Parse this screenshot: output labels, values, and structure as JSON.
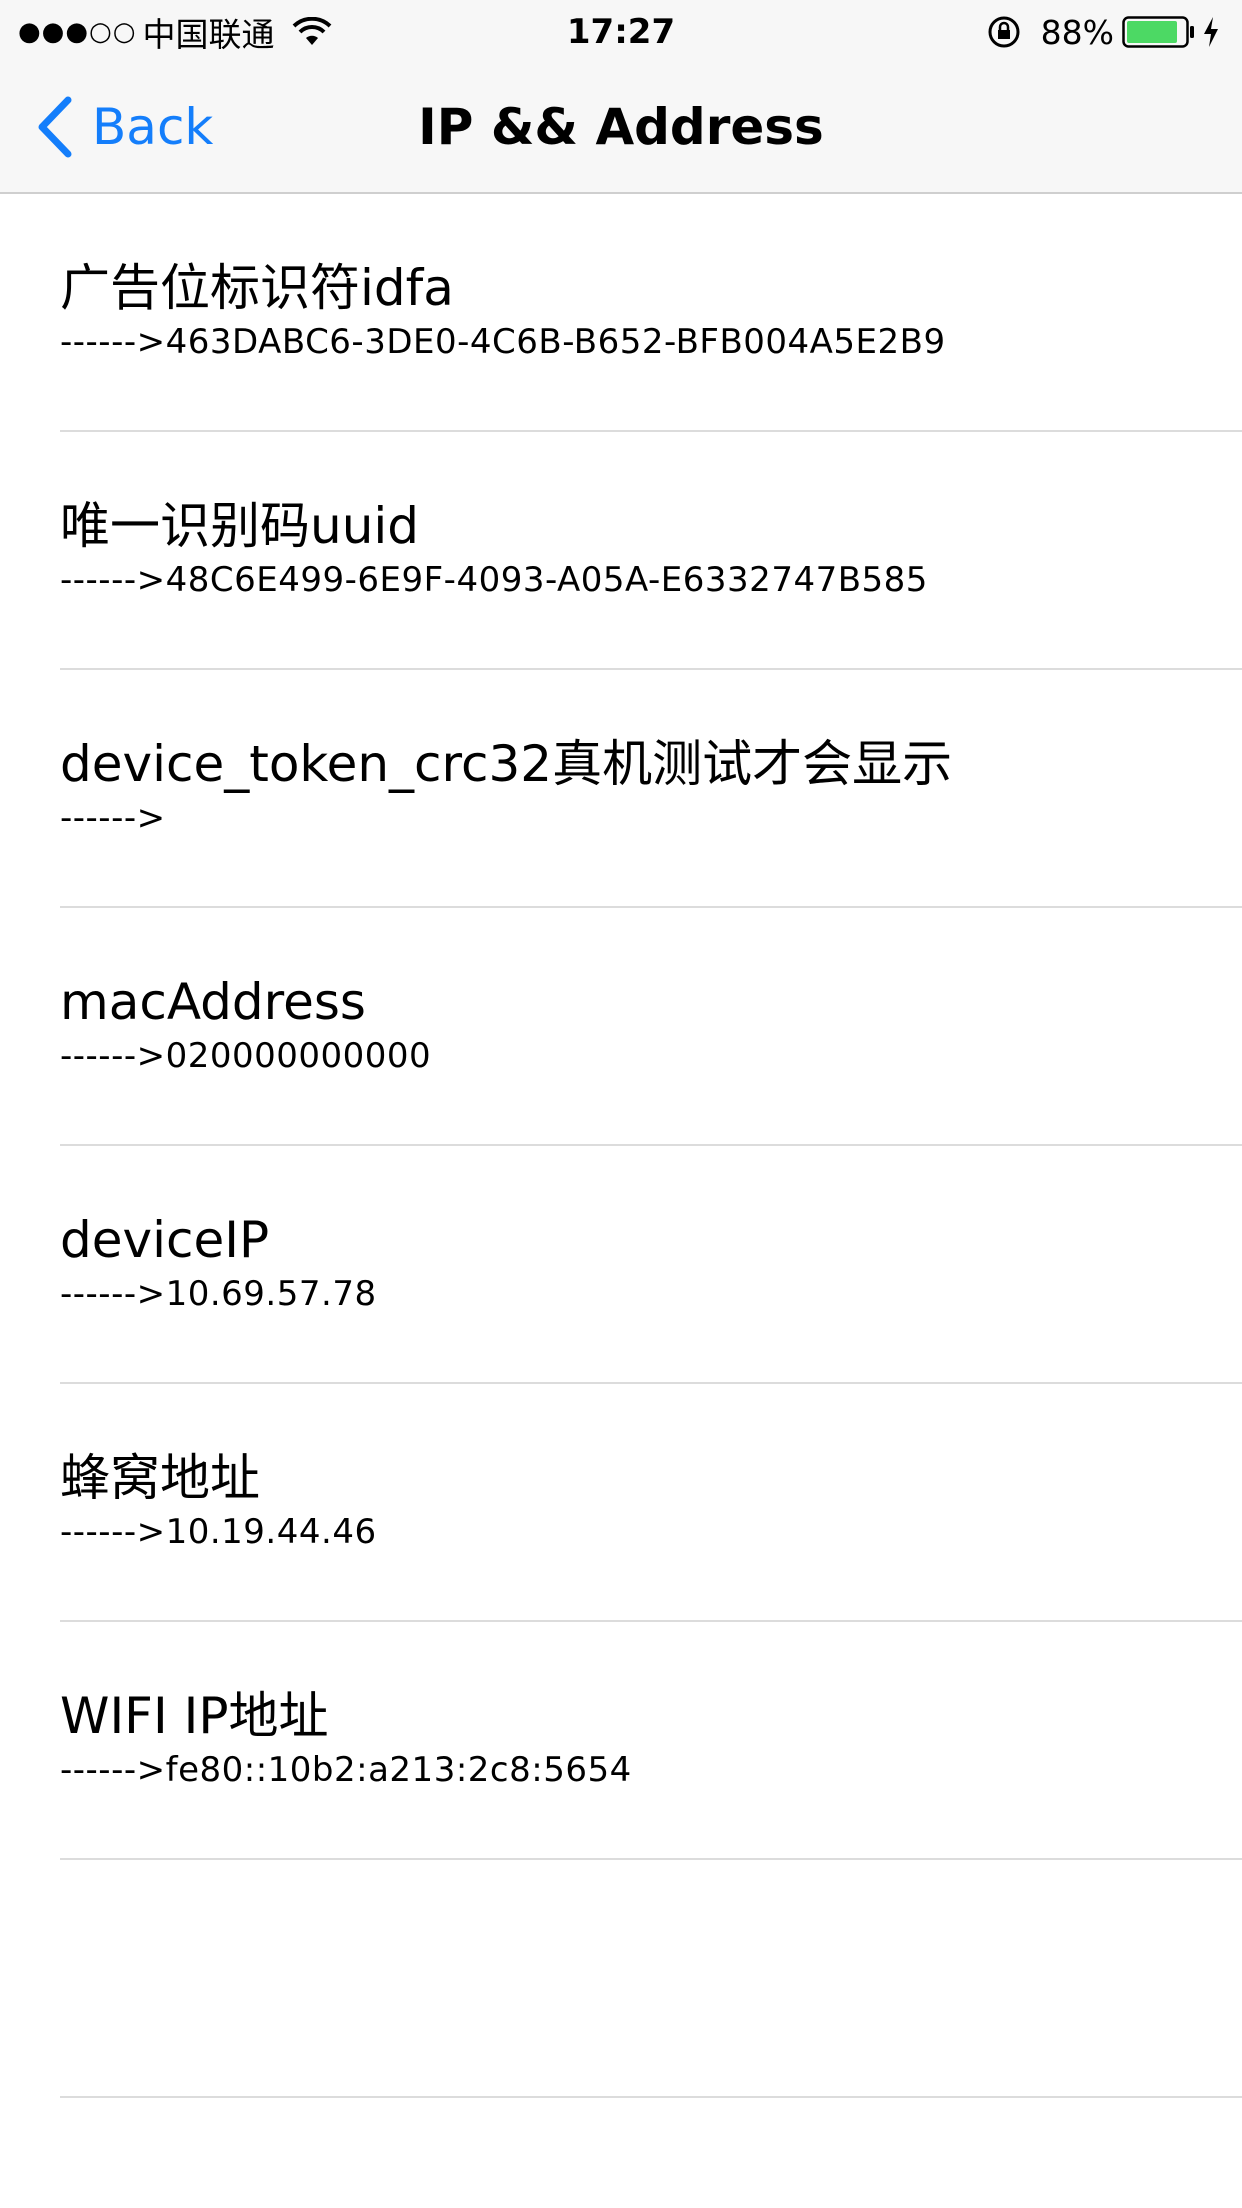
{
  "status_bar": {
    "signal": "●●●○○",
    "carrier": "中国联通",
    "time": "17:27",
    "battery_percent": "88%",
    "battery_level": 0.88,
    "icons": [
      "wifi-icon",
      "rotation-lock-icon",
      "battery-icon",
      "charging-bolt-icon"
    ]
  },
  "nav": {
    "back_label": "Back",
    "title": "IP && Address",
    "accent_color": "#147efb"
  },
  "rows": [
    {
      "title": "广告位标识符idfa",
      "value": "------>463DABC6-3DE0-4C6B-B652-BFB004A5E2B9"
    },
    {
      "title": "唯一识别码uuid",
      "value": "------>48C6E499-6E9F-4093-A05A-E6332747B585"
    },
    {
      "title": "device_token_crc32真机测试才会显示",
      "value": "------>"
    },
    {
      "title": "macAddress",
      "value": "------>020000000000"
    },
    {
      "title": "deviceIP",
      "value": "------>10.69.57.78"
    },
    {
      "title": "蜂窝地址",
      "value": "------>10.19.44.46"
    },
    {
      "title": "WIFI IP地址",
      "value": "------>fe80::10b2:a213:2c8:5654"
    }
  ]
}
